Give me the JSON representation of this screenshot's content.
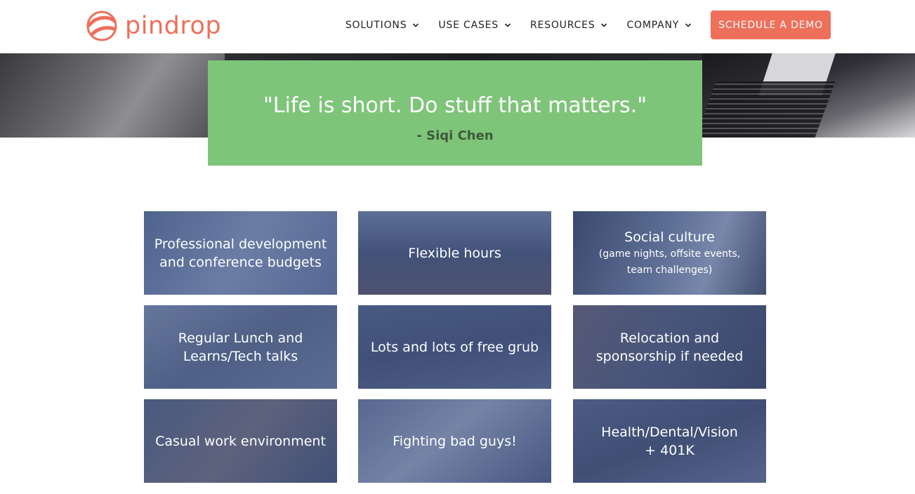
{
  "header": {
    "logo_text": "pindrop",
    "nav": [
      {
        "label": "SOLUTIONS"
      },
      {
        "label": "USE CASES"
      },
      {
        "label": "RESOURCES"
      },
      {
        "label": "COMPANY"
      }
    ],
    "cta_label": "SCHEDULE A DEMO"
  },
  "quote": {
    "text": "\"Life is short. Do stuff that matters.\"",
    "author": "- Siqi Chen"
  },
  "benefits": [
    {
      "label": "Professional development\nand conference budgets",
      "sub": ""
    },
    {
      "label": "Flexible hours",
      "sub": ""
    },
    {
      "label": "Social culture",
      "sub": "(game nights, offsite events,\nteam challenges)"
    },
    {
      "label": "Regular Lunch and\nLearns/Tech talks",
      "sub": ""
    },
    {
      "label": "Lots and lots of free grub",
      "sub": ""
    },
    {
      "label": "Relocation and\nsponsorship if needed",
      "sub": ""
    },
    {
      "label": "Casual work environment",
      "sub": ""
    },
    {
      "label": "Fighting bad guys!",
      "sub": ""
    },
    {
      "label": "Health/Dental/Vision\n+ 401K",
      "sub": ""
    }
  ],
  "colors": {
    "brand": "#ee6f5a",
    "quote_bg": "#7ec479",
    "tile_overlay": "#465a8c"
  }
}
